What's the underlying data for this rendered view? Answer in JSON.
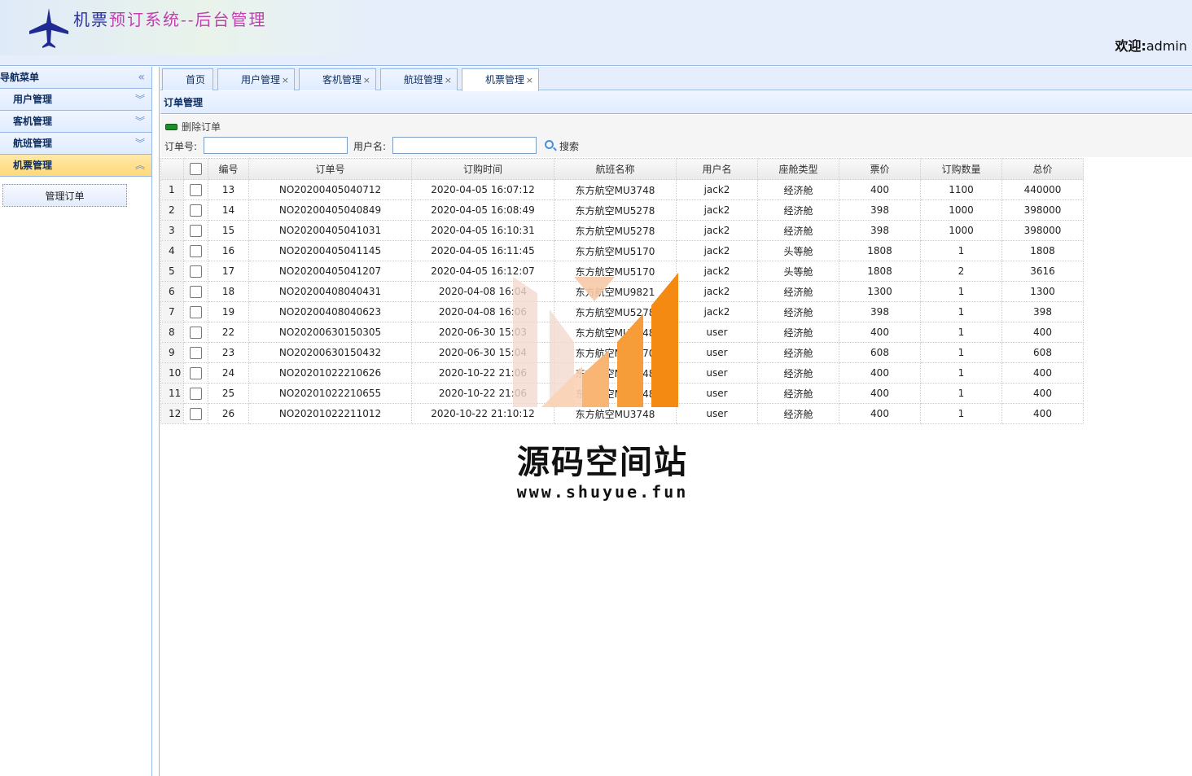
{
  "header": {
    "title_part1": "机票",
    "title_part2": "预订系统--后台管理",
    "welcome_label": "欢迎:",
    "username": "admin"
  },
  "sidebar": {
    "title": "导航菜单",
    "items": [
      {
        "label": "用户管理"
      },
      {
        "label": "客机管理"
      },
      {
        "label": "航班管理"
      },
      {
        "label": "机票管理"
      }
    ],
    "sub_button": "管理订单"
  },
  "tabs": [
    {
      "label": "首页"
    },
    {
      "label": "用户管理"
    },
    {
      "label": "客机管理"
    },
    {
      "label": "航班管理"
    },
    {
      "label": "机票管理"
    }
  ],
  "panel": {
    "title": "订单管理",
    "delete_label": "删除订单",
    "order_no_label": "订单号:",
    "username_label": "用户名:",
    "search_label": "搜索"
  },
  "table": {
    "columns": [
      "编号",
      "订单号",
      "订购时间",
      "航班名称",
      "用户名",
      "座舱类型",
      "票价",
      "订购数量",
      "总价"
    ],
    "rows": [
      [
        "13",
        "NO20200405040712",
        "2020-04-05 16:07:12",
        "东方航空MU3748",
        "jack2",
        "经济舱",
        "400",
        "1100",
        "440000"
      ],
      [
        "14",
        "NO20200405040849",
        "2020-04-05 16:08:49",
        "东方航空MU5278",
        "jack2",
        "经济舱",
        "398",
        "1000",
        "398000"
      ],
      [
        "15",
        "NO20200405041031",
        "2020-04-05 16:10:31",
        "东方航空MU5278",
        "jack2",
        "经济舱",
        "398",
        "1000",
        "398000"
      ],
      [
        "16",
        "NO20200405041145",
        "2020-04-05 16:11:45",
        "东方航空MU5170",
        "jack2",
        "头等舱",
        "1808",
        "1",
        "1808"
      ],
      [
        "17",
        "NO20200405041207",
        "2020-04-05 16:12:07",
        "东方航空MU5170",
        "jack2",
        "头等舱",
        "1808",
        "2",
        "3616"
      ],
      [
        "18",
        "NO20200408040431",
        "2020-04-08 16:04",
        "东方航空MU9821",
        "jack2",
        "经济舱",
        "1300",
        "1",
        "1300"
      ],
      [
        "19",
        "NO20200408040623",
        "2020-04-08 16:06",
        "东方航空MU5278",
        "jack2",
        "经济舱",
        "398",
        "1",
        "398"
      ],
      [
        "22",
        "NO20200630150305",
        "2020-06-30 15:03",
        "东方航空MU3748",
        "user",
        "经济舱",
        "400",
        "1",
        "400"
      ],
      [
        "23",
        "NO20200630150432",
        "2020-06-30 15:04",
        "东方航空MU5170",
        "user",
        "经济舱",
        "608",
        "1",
        "608"
      ],
      [
        "24",
        "NO20201022210626",
        "2020-10-22 21:06",
        "东方航空MU3748",
        "user",
        "经济舱",
        "400",
        "1",
        "400"
      ],
      [
        "25",
        "NO20201022210655",
        "2020-10-22 21:06",
        "东方航空MU3748",
        "user",
        "经济舱",
        "400",
        "1",
        "400"
      ],
      [
        "26",
        "NO20201022211012",
        "2020-10-22 21:10:12",
        "东方航空MU3748",
        "user",
        "经济舱",
        "400",
        "1",
        "400"
      ]
    ]
  },
  "watermark": {
    "text": "源码空间站",
    "url": "www.shuyue.fun"
  }
}
